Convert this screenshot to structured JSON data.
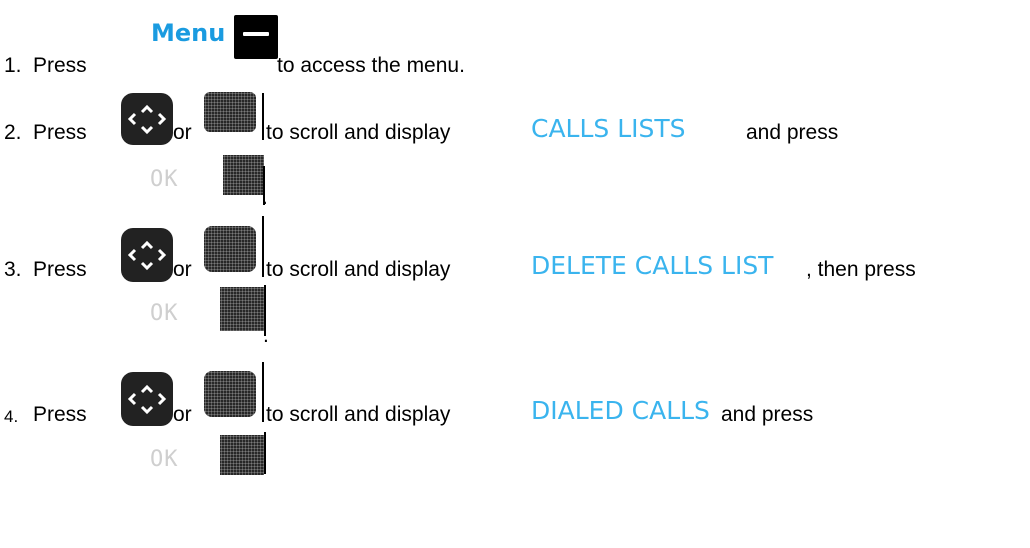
{
  "steps": [
    {
      "number": "1.",
      "press": "Press",
      "after_menu": "to access the menu.",
      "menu_label": "Menu"
    },
    {
      "number": "2.",
      "press": "Press",
      "or": "or",
      "scroll_text": "to scroll and display",
      "highlight": "CALLS LISTS",
      "tail": "and press",
      "ok_label": "OK",
      "period": "."
    },
    {
      "number": "3.",
      "press": "Press",
      "or": "or",
      "scroll_text": "to scroll and display",
      "highlight": "DELETE CALLS LIST",
      "tail": ", then press",
      "ok_label": "OK",
      "period": "."
    },
    {
      "number": "4.",
      "press": "Press",
      "or": "or",
      "scroll_text": "to scroll and display",
      "highlight": "DIALED CALLS",
      "tail": "and press",
      "ok_label": "OK"
    }
  ],
  "colors": {
    "highlight": "#3ab4ee",
    "menu": "#1a9be0"
  },
  "icons": [
    "menu-softkey-icon",
    "nav-key-icon",
    "nav-key-dotted-icon",
    "ok-softkey-icon"
  ]
}
